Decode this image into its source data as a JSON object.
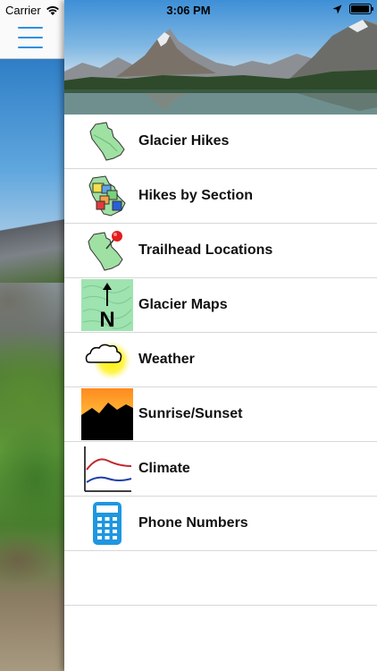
{
  "status_bar": {
    "carrier": "Carrier",
    "time": "3:06 PM",
    "battery_level": 0.95
  },
  "nav": {
    "menu_icon": "hamburger-menu-icon",
    "accent_color": "#2f8fe0"
  },
  "drawer": {
    "header_image": "mountain-lake-landscape",
    "items": [
      {
        "label": "Glacier Hikes",
        "icon": "park-map-icon"
      },
      {
        "label": "Hikes by Section",
        "icon": "section-map-icon"
      },
      {
        "label": "Trailhead Locations",
        "icon": "map-pin-icon"
      },
      {
        "label": "Glacier Maps",
        "icon": "north-arrow-map-icon"
      },
      {
        "label": "Weather",
        "icon": "cloud-sun-icon"
      },
      {
        "label": "Sunrise/Sunset",
        "icon": "sunset-mountain-icon"
      },
      {
        "label": "Climate",
        "icon": "climate-chart-icon"
      },
      {
        "label": "Phone Numbers",
        "icon": "calculator-phone-icon"
      }
    ]
  }
}
